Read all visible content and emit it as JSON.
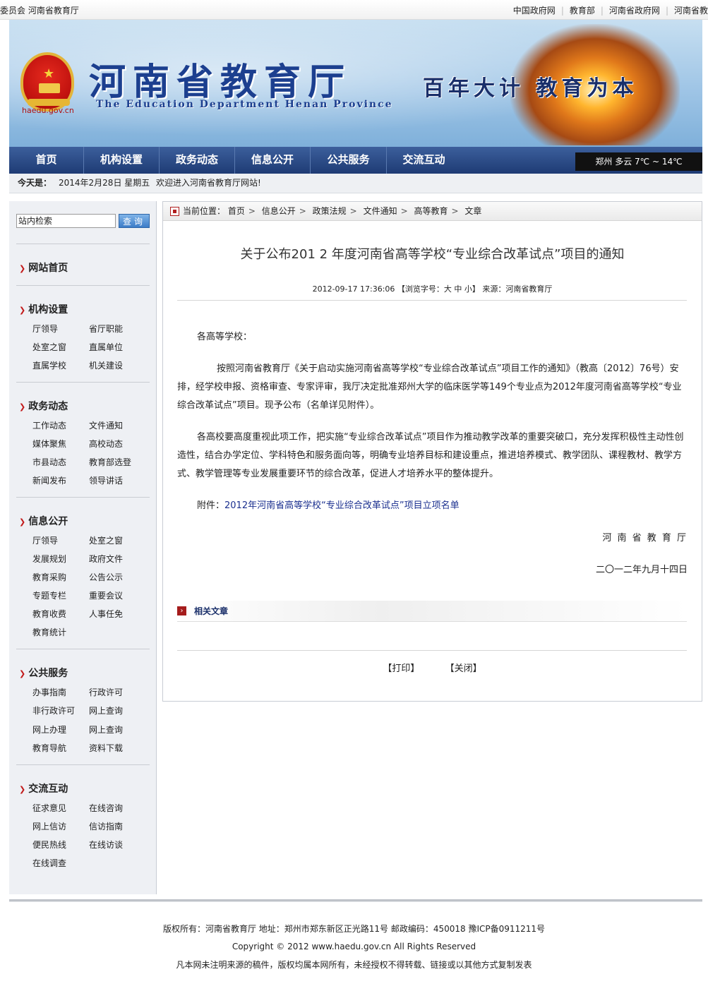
{
  "topbar": {
    "left_text": "委员会  河南省教育厅",
    "links": [
      "中国政府网",
      "教育部",
      "河南省政府网",
      "河南省教"
    ]
  },
  "header": {
    "domain": "haedu.gov.cn",
    "title": "河南省教育厅",
    "subtitle": "The Education Department Henan Province",
    "slogan": "百年大计  教育为本"
  },
  "nav": {
    "items": [
      "首页",
      "机构设置",
      "政务动态",
      "信息公开",
      "公共服务",
      "交流互动"
    ],
    "weather": "郑州 多云 7℃ ~ 14℃"
  },
  "datebar": {
    "label": "今天是：",
    "date": "2014年2月28日  星期五",
    "welcome": "欢迎进入河南省教育厅网站!"
  },
  "sidebar": {
    "search_value": "站内检索",
    "search_button": "查询",
    "home_label": "网站首页",
    "sections": [
      {
        "title": "机构设置",
        "links": [
          "厅领导",
          "省厅职能",
          "处室之窗",
          "直属单位",
          "直属学校",
          "机关建设"
        ]
      },
      {
        "title": "政务动态",
        "links": [
          "工作动态",
          "文件通知",
          "媒体聚焦",
          "高校动态",
          "市县动态",
          "教育部选登",
          "新闻发布",
          "领导讲话"
        ]
      },
      {
        "title": "信息公开",
        "links": [
          "厅领导",
          "处室之窗",
          "发展规划",
          "政府文件",
          "教育采购",
          "公告公示",
          "专题专栏",
          "重要会议",
          "教育收费",
          "人事任免",
          "教育统计"
        ]
      },
      {
        "title": "公共服务",
        "links": [
          "办事指南",
          "行政许可",
          "非行政许可",
          "网上查询",
          "网上办理",
          "网上查询",
          "教育导航",
          "资料下载"
        ]
      },
      {
        "title": "交流互动",
        "links": [
          "征求意见",
          "在线咨询",
          "网上信访",
          "信访指南",
          "便民热线",
          "在线访谈",
          "在线调查"
        ]
      }
    ]
  },
  "breadcrumb": {
    "label": "当前位置：",
    "items": [
      "首页",
      "信息公开",
      "政策法规",
      "文件通知",
      "高等教育",
      "文章"
    ]
  },
  "article": {
    "title": "关于公布201 2 年度河南省高等学校“专业综合改革试点”项目的通知",
    "meta": "2012-09-17 17:36:06 【浏览字号：大 中 小】 来源：河南省教育厅",
    "salutation": "各高等学校：",
    "para1": "按照河南省教育厅《关于启动实施河南省高等学校“专业综合改革试点”项目工作的通知》（教高〔2012〕76号）安排，经学校申报、资格审查、专家评审，我厅决定批准郑州大学的临床医学等149个专业点为2012年度河南省高等学校“专业综合改革试点”项目。现予公布（名单详见附件）。",
    "para2": "各高校要高度重视此项工作，把实施“专业综合改革试点”项目作为推动教学改革的重要突破口，充分发挥积极性主动性创造性，结合办学定位、学科特色和服务面向等，明确专业培养目标和建设重点，推进培养模式、教学团队、课程教材、教学方式、教学管理等专业发展重要环节的综合改革，促进人才培养水平的整体提升。",
    "attachment_label": "附件：",
    "attachment_link": "2012年河南省高等学校“专业综合改革试点”项目立项名单",
    "signer": "河 南 省 教 育 厅",
    "sign_date": "二〇一二年九月十四日",
    "related_label": "相关文章",
    "print_label": "【打印】",
    "close_label": "【关闭】"
  },
  "footer": {
    "line1": "版权所有：河南省教育厅  地址：郑州市郑东新区正光路11号  邮政编码：450018 豫ICP备0911211号",
    "line2": "Copyright © 2012 www.haedu.gov.cn All Rights Reserved",
    "line3": "凡本网未注明来源的稿件，版权均属本网所有，未经授权不得转载、链接或以其他方式复制发表"
  },
  "colors": {
    "nav_bg": "#1e3b74",
    "accent_red": "#c21a1a",
    "link_blue": "#1a2f8f",
    "sidebar_bg": "#eef0f4"
  }
}
